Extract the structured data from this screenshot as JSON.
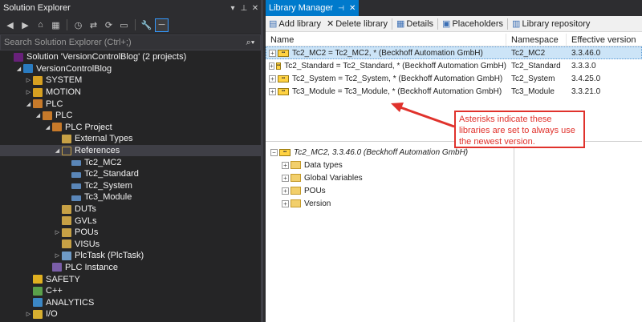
{
  "solution_explorer": {
    "title": "Solution Explorer",
    "search_placeholder": "Search Solution Explorer (Ctrl+;)",
    "tree": [
      {
        "label": "Solution 'VersionControlBlog' (2 projects)",
        "icon": "solution-icon"
      },
      {
        "label": "VersionControlBlog",
        "icon": "project-icon"
      },
      {
        "label": "SYSTEM",
        "icon": "system-icon"
      },
      {
        "label": "MOTION",
        "icon": "motion-icon"
      },
      {
        "label": "PLC",
        "icon": "plc-icon"
      },
      {
        "label": "PLC",
        "icon": "plc-icon"
      },
      {
        "label": "PLC Project",
        "icon": "plc-project-icon"
      },
      {
        "label": "External Types",
        "icon": "folder-icon"
      },
      {
        "label": "References",
        "icon": "folder-open-icon"
      },
      {
        "label": "Tc2_MC2",
        "icon": "library-icon"
      },
      {
        "label": "Tc2_Standard",
        "icon": "library-icon"
      },
      {
        "label": "Tc2_System",
        "icon": "library-icon"
      },
      {
        "label": "Tc3_Module",
        "icon": "library-icon"
      },
      {
        "label": "DUTs",
        "icon": "folder-icon"
      },
      {
        "label": "GVLs",
        "icon": "folder-icon"
      },
      {
        "label": "POUs",
        "icon": "folder-icon"
      },
      {
        "label": "VISUs",
        "icon": "folder-icon"
      },
      {
        "label": "PlcTask (PlcTask)",
        "icon": "task-icon"
      },
      {
        "label": "PLC Instance",
        "icon": "instance-icon"
      },
      {
        "label": "SAFETY",
        "icon": "safety-icon"
      },
      {
        "label": "C++",
        "icon": "cpp-icon"
      },
      {
        "label": "ANALYTICS",
        "icon": "analytics-icon"
      },
      {
        "label": "I/O",
        "icon": "io-icon"
      }
    ]
  },
  "library_manager": {
    "tab_title": "Library Manager",
    "toolbar": {
      "add_library": "Add library",
      "delete_library": "Delete library",
      "details": "Details",
      "placeholders": "Placeholders",
      "library_repository": "Library repository"
    },
    "columns": {
      "name": "Name",
      "namespace": "Namespace",
      "effective_version": "Effective version"
    },
    "rows": [
      {
        "name": "Tc2_MC2 = Tc2_MC2, * (Beckhoff Automation GmbH)",
        "namespace": "Tc2_MC2",
        "version": "3.3.46.0"
      },
      {
        "name": "Tc2_Standard = Tc2_Standard, * (Beckhoff Automation GmbH)",
        "namespace": "Tc2_Standard",
        "version": "3.3.3.0"
      },
      {
        "name": "Tc2_System = Tc2_System, * (Beckhoff Automation GmbH)",
        "namespace": "Tc2_System",
        "version": "3.4.25.0"
      },
      {
        "name": "Tc3_Module = Tc3_Module, * (Beckhoff Automation GmbH)",
        "namespace": "Tc3_Module",
        "version": "3.3.21.0"
      }
    ],
    "detail_tree": {
      "root": "Tc2_MC2, 3.3.46.0 (Beckhoff Automation GmbH)",
      "children": [
        "Data types",
        "Global Variables",
        "POUs",
        "Version"
      ]
    }
  },
  "annotation": {
    "text": "Asterisks indicate these libraries are set to always use the newest version.",
    "color": "#e0322c"
  },
  "colors": {
    "accent": "#007acc",
    "dark_bg": "#252526",
    "selection_light": "#cce4f7"
  }
}
